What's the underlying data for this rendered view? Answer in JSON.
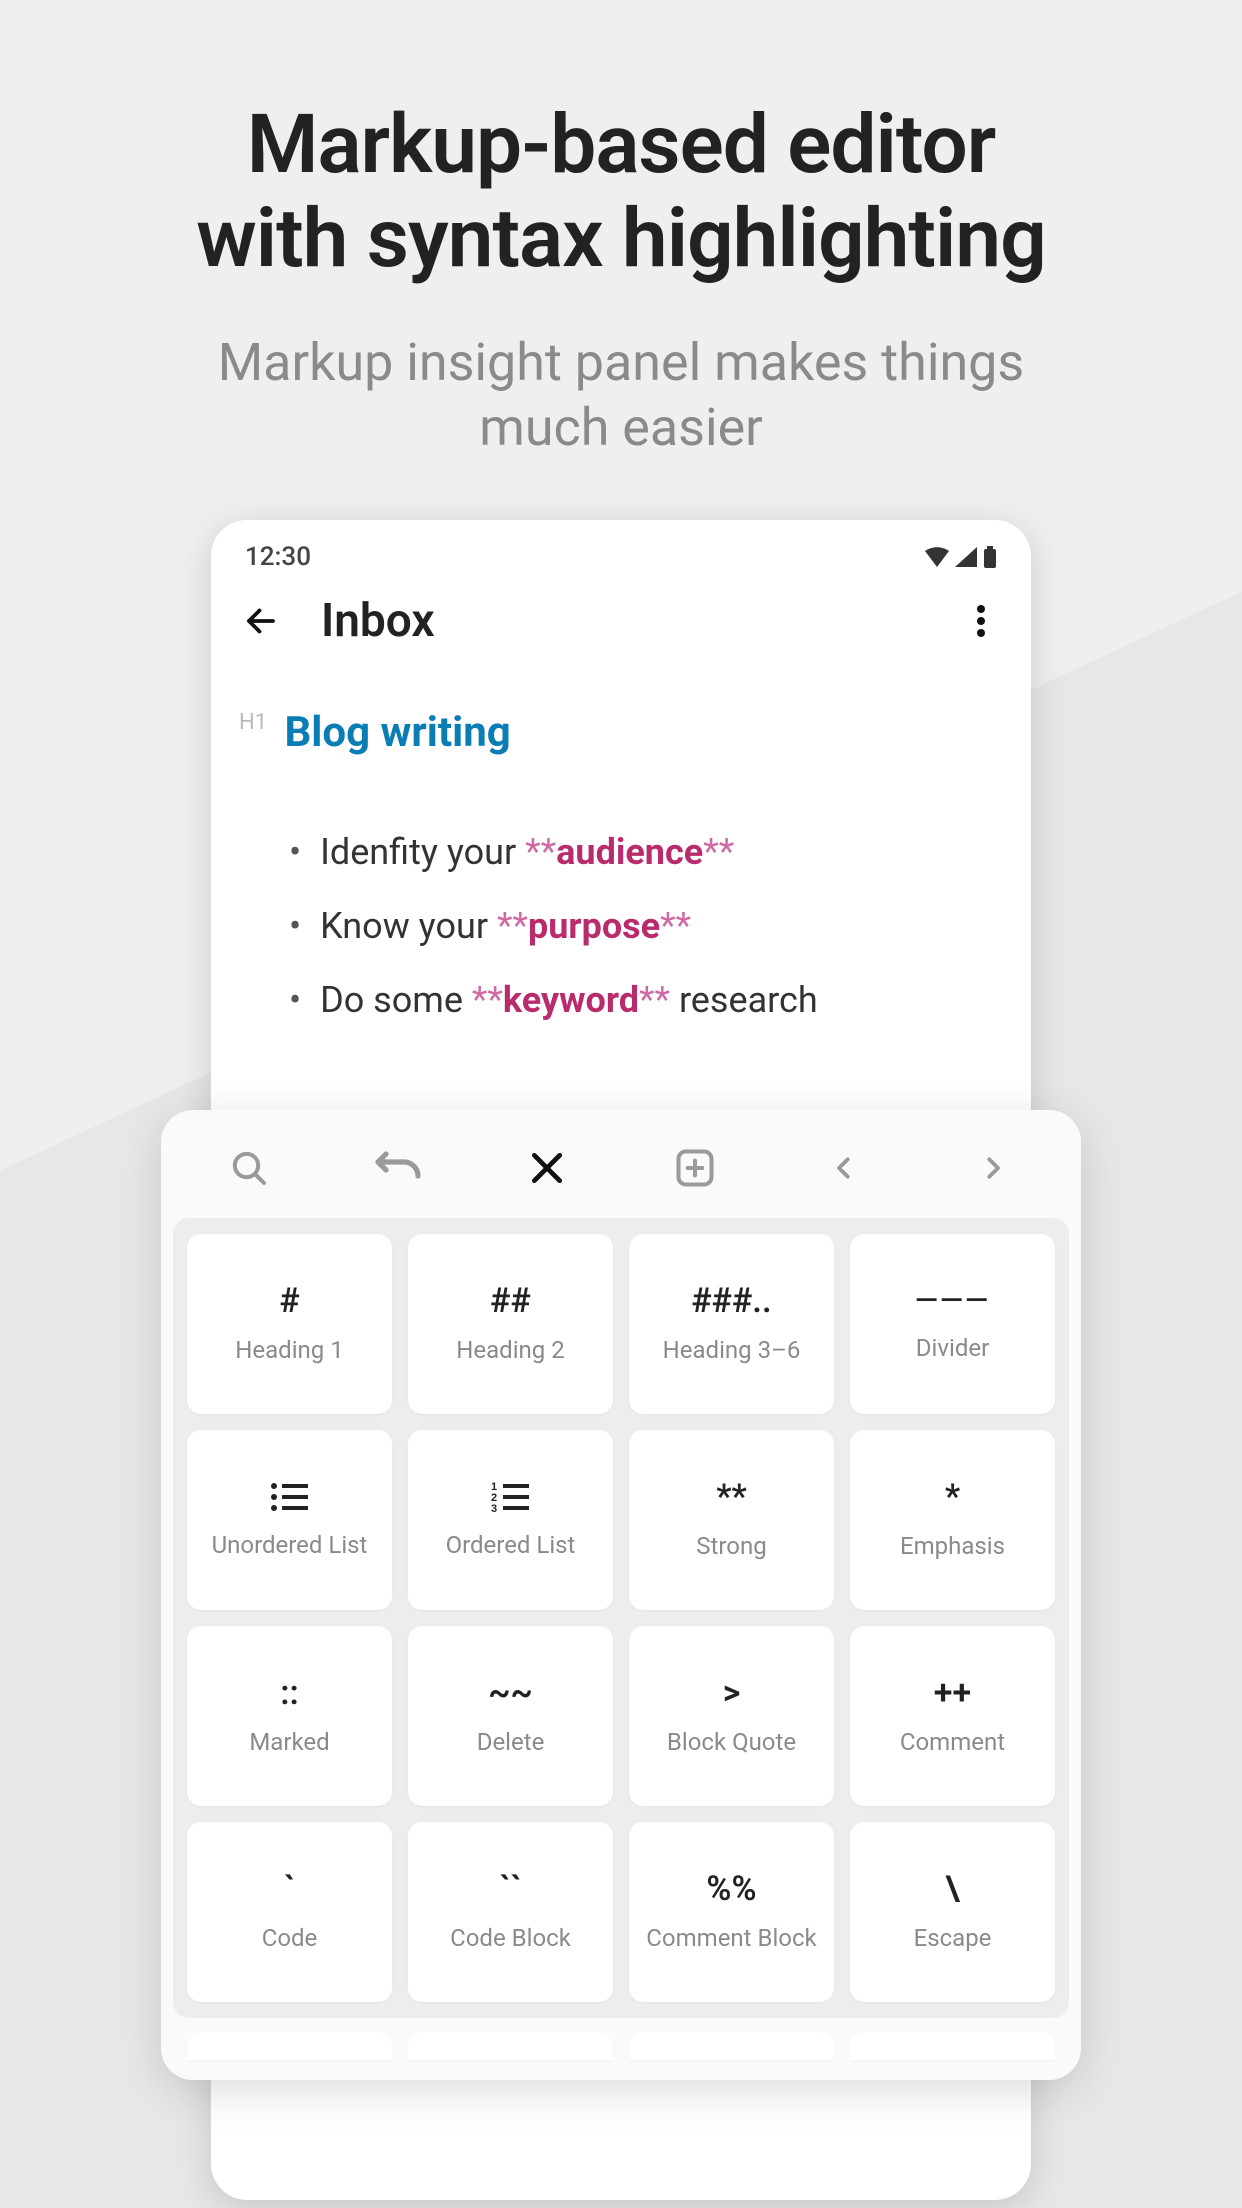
{
  "promo": {
    "title_line1": "Markup-based editor",
    "title_line2": "with syntax highlighting",
    "subtitle_line1": "Markup insight panel makes things",
    "subtitle_line2": "much easier"
  },
  "statusbar": {
    "time": "12:30"
  },
  "appbar": {
    "title": "Inbox"
  },
  "editor": {
    "h1_tag": "H1",
    "h1_text": "Blog writing",
    "bullets": [
      {
        "pre": "Idenfity your ",
        "stars": "**",
        "bold": "audience",
        "post": ""
      },
      {
        "pre": "Know your ",
        "stars": "**",
        "bold": "purpose",
        "post": ""
      },
      {
        "pre": "Do some ",
        "stars": "**",
        "bold": "keyword",
        "post": " research"
      }
    ]
  },
  "panel": {
    "cells": [
      {
        "sym": "#",
        "lbl": "Heading 1"
      },
      {
        "sym": "##",
        "lbl": "Heading 2"
      },
      {
        "sym": "###..",
        "lbl": "Heading 3–6"
      },
      {
        "sym": "———",
        "lbl": "Divider"
      },
      {
        "sym": "ul-icon",
        "lbl": "Unordered List"
      },
      {
        "sym": "ol-icon",
        "lbl": "Ordered List"
      },
      {
        "sym": "**",
        "lbl": "Strong"
      },
      {
        "sym": "*",
        "lbl": "Emphasis"
      },
      {
        "sym": "::",
        "lbl": "Marked"
      },
      {
        "sym": "~~",
        "lbl": "Delete"
      },
      {
        "sym": ">",
        "lbl": "Block Quote"
      },
      {
        "sym": "++",
        "lbl": "Comment"
      },
      {
        "sym": "`",
        "lbl": "Code"
      },
      {
        "sym": "``",
        "lbl": "Code Block"
      },
      {
        "sym": "%%",
        "lbl": "Comment Block"
      },
      {
        "sym": "\\",
        "lbl": "Escape"
      }
    ]
  }
}
